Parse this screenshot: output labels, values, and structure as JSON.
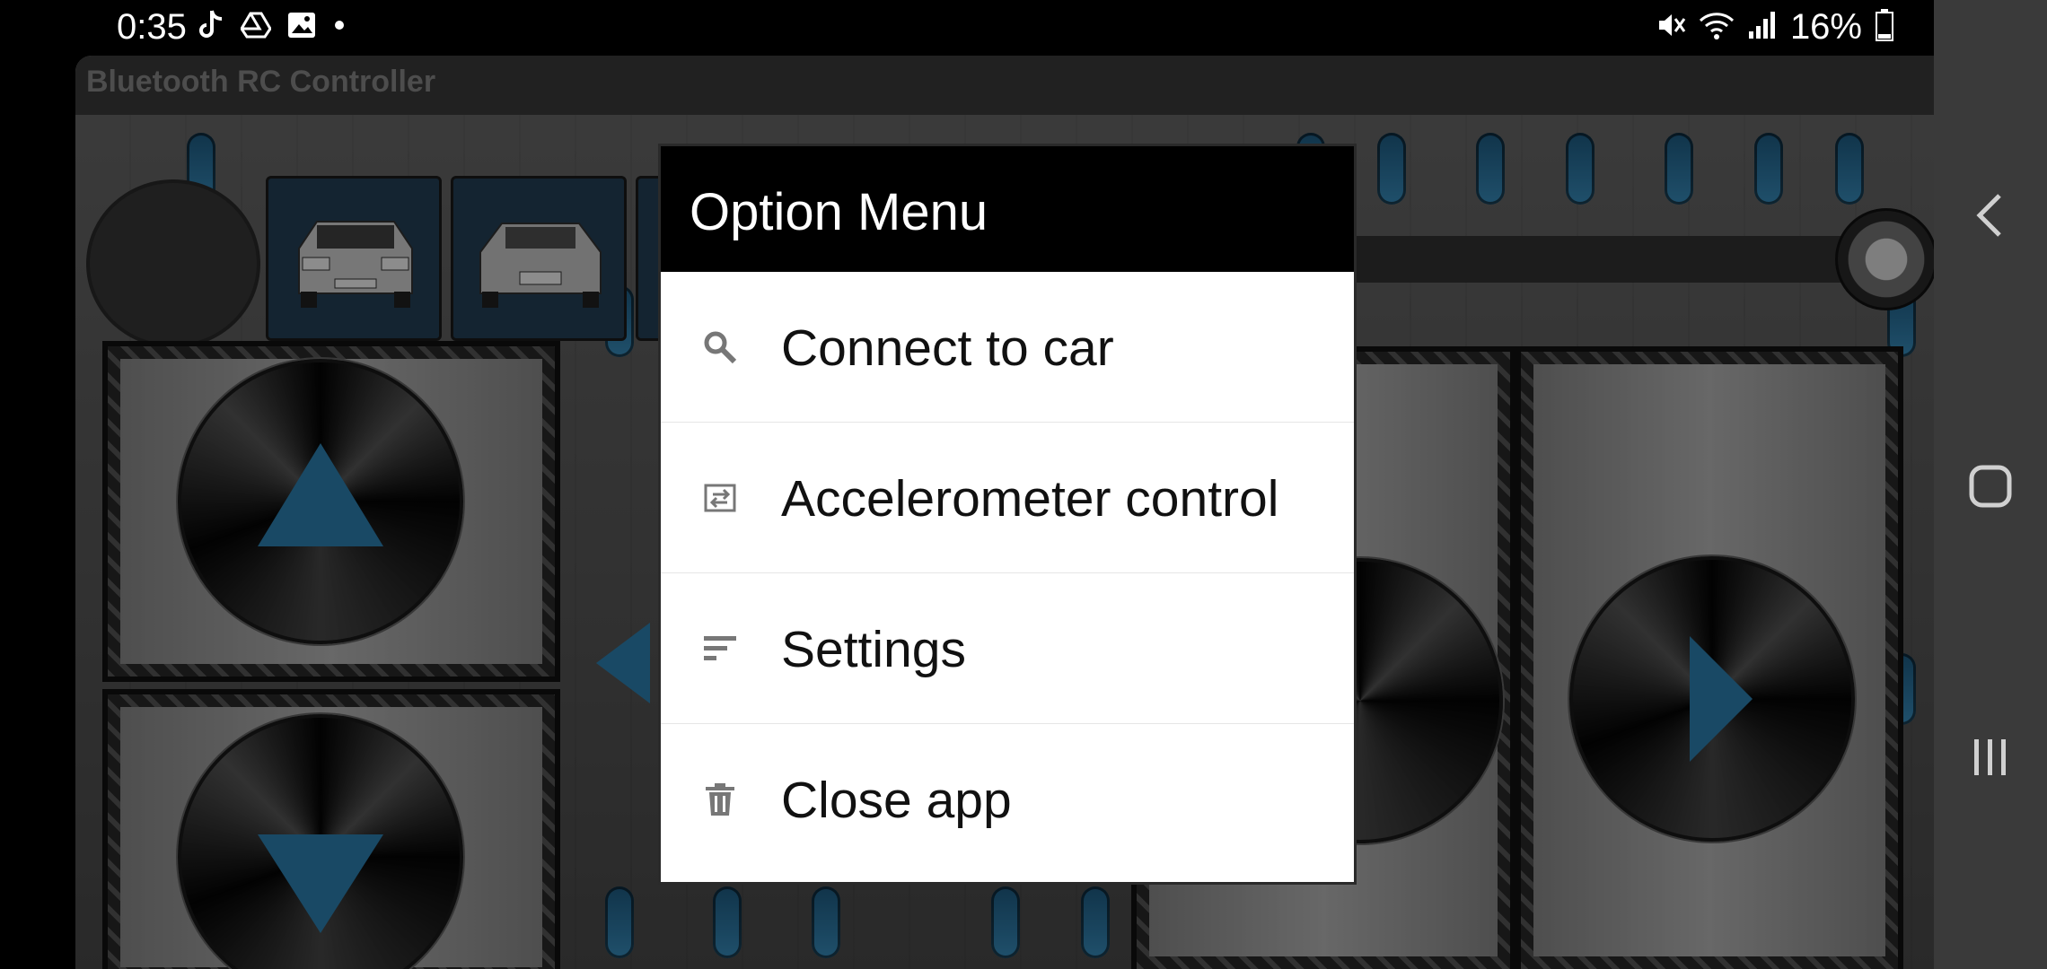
{
  "status_bar": {
    "time": "0:35",
    "battery": "16%",
    "left_icons": [
      "tiktok-icon",
      "drive-icon",
      "gallery-icon",
      "dot-icon"
    ],
    "right_icons": [
      "mute-icon",
      "wifi-icon",
      "signal-icon",
      "battery-icon"
    ]
  },
  "app": {
    "title": "Bluetooth RC Controller"
  },
  "dialog": {
    "title": "Option Menu",
    "items": [
      {
        "label": "Connect to car",
        "icon": "search-icon"
      },
      {
        "label": "Accelerometer control",
        "icon": "rotate-icon"
      },
      {
        "label": "Settings",
        "icon": "sort-icon"
      },
      {
        "label": "Close app",
        "icon": "trash-icon"
      }
    ]
  },
  "nav": {
    "buttons": [
      "back-icon",
      "home-icon",
      "recents-icon"
    ]
  },
  "colors": {
    "accent_blue": "#2f86b8",
    "dialog_header": "#000000",
    "dialog_bg": "#ffffff",
    "nav_bg": "#3a3a3a"
  }
}
